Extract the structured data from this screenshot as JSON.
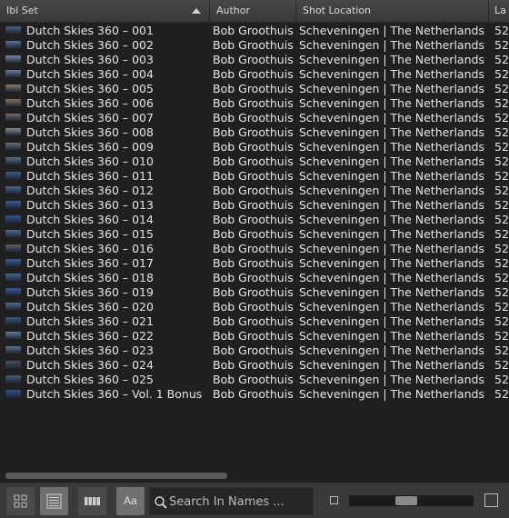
{
  "columns": {
    "ibl_set": "Ibl Set",
    "author": "Author",
    "shot_location": "Shot Location",
    "extra": "La"
  },
  "rows": [
    {
      "name": "Dutch Skies 360 – 001",
      "author": "Bob Groothuis",
      "location": "Scheveningen | The Netherlands",
      "extra": "52",
      "thumb_color": "#4a5f7e"
    },
    {
      "name": "Dutch Skies 360 – 002",
      "author": "Bob Groothuis",
      "location": "Scheveningen | The Netherlands",
      "extra": "52",
      "thumb_color": "#5d7091"
    },
    {
      "name": "Dutch Skies 360 – 003",
      "author": "Bob Groothuis",
      "location": "Scheveningen | The Netherlands",
      "extra": "52",
      "thumb_color": "#7c8aa0"
    },
    {
      "name": "Dutch Skies 360 – 004",
      "author": "Bob Groothuis",
      "location": "Scheveningen | The Netherlands",
      "extra": "52",
      "thumb_color": "#6e7c92"
    },
    {
      "name": "Dutch Skies 360 – 005",
      "author": "Bob Groothuis",
      "location": "Scheveningen | The Netherlands",
      "extra": "52",
      "thumb_color": "#8a7a6a"
    },
    {
      "name": "Dutch Skies 360 – 006",
      "author": "Bob Groothuis",
      "location": "Scheveningen | The Netherlands",
      "extra": "52",
      "thumb_color": "#8f6e55"
    },
    {
      "name": "Dutch Skies 360 – 007",
      "author": "Bob Groothuis",
      "location": "Scheveningen | The Netherlands",
      "extra": "52",
      "thumb_color": "#7a6a5e"
    },
    {
      "name": "Dutch Skies 360 – 008",
      "author": "Bob Groothuis",
      "location": "Scheveningen | The Netherlands",
      "extra": "52",
      "thumb_color": "#8a8a88"
    },
    {
      "name": "Dutch Skies 360 – 009",
      "author": "Bob Groothuis",
      "location": "Scheveningen | The Netherlands",
      "extra": "52",
      "thumb_color": "#6d6d70"
    },
    {
      "name": "Dutch Skies 360 – 010",
      "author": "Bob Groothuis",
      "location": "Scheveningen | The Netherlands",
      "extra": "52",
      "thumb_color": "#5a6c84"
    },
    {
      "name": "Dutch Skies 360 – 011",
      "author": "Bob Groothuis",
      "location": "Scheveningen | The Netherlands",
      "extra": "52",
      "thumb_color": "#3f5a86"
    },
    {
      "name": "Dutch Skies 360 – 012",
      "author": "Bob Groothuis",
      "location": "Scheveningen | The Netherlands",
      "extra": "52",
      "thumb_color": "#4d6590"
    },
    {
      "name": "Dutch Skies 360 – 013",
      "author": "Bob Groothuis",
      "location": "Scheveningen | The Netherlands",
      "extra": "52",
      "thumb_color": "#3a5c8e"
    },
    {
      "name": "Dutch Skies 360 – 014",
      "author": "Bob Groothuis",
      "location": "Scheveningen | The Netherlands",
      "extra": "52",
      "thumb_color": "#34578f"
    },
    {
      "name": "Dutch Skies 360 – 015",
      "author": "Bob Groothuis",
      "location": "Scheveningen | The Netherlands",
      "extra": "52",
      "thumb_color": "#4f6a8c"
    },
    {
      "name": "Dutch Skies 360 – 016",
      "author": "Bob Groothuis",
      "location": "Scheveningen | The Netherlands",
      "extra": "52",
      "thumb_color": "#5e5e62"
    },
    {
      "name": "Dutch Skies 360 – 017",
      "author": "Bob Groothuis",
      "location": "Scheveningen | The Netherlands",
      "extra": "52",
      "thumb_color": "#3d5f96"
    },
    {
      "name": "Dutch Skies 360 – 018",
      "author": "Bob Groothuis",
      "location": "Scheveningen | The Netherlands",
      "extra": "52",
      "thumb_color": "#466795"
    },
    {
      "name": "Dutch Skies 360 – 019",
      "author": "Bob Groothuis",
      "location": "Scheveningen | The Netherlands",
      "extra": "52",
      "thumb_color": "#355a92"
    },
    {
      "name": "Dutch Skies 360 – 020",
      "author": "Bob Groothuis",
      "location": "Scheveningen | The Netherlands",
      "extra": "52",
      "thumb_color": "#55698a"
    },
    {
      "name": "Dutch Skies 360 – 021",
      "author": "Bob Groothuis",
      "location": "Scheveningen | The Netherlands",
      "extra": "52",
      "thumb_color": "#3e5680"
    },
    {
      "name": "Dutch Skies 360 – 022",
      "author": "Bob Groothuis",
      "location": "Scheveningen | The Netherlands",
      "extra": "52",
      "thumb_color": "#6a7890"
    },
    {
      "name": "Dutch Skies 360 – 023",
      "author": "Bob Groothuis",
      "location": "Scheveningen | The Netherlands",
      "extra": "52",
      "thumb_color": "#5c6f8a"
    },
    {
      "name": "Dutch Skies 360 – 024",
      "author": "Bob Groothuis",
      "location": "Scheveningen | The Netherlands",
      "extra": "52",
      "thumb_color": "#4b4f58"
    },
    {
      "name": "Dutch Skies 360 – 025",
      "author": "Bob Groothuis",
      "location": "Scheveningen | The Netherlands",
      "extra": "52",
      "thumb_color": "#4a5870"
    },
    {
      "name": "Dutch Skies 360 – Vol. 1 Bonus",
      "author": "Bob Groothuis",
      "location": "Scheveningen | The Netherlands",
      "extra": "52",
      "thumb_color": "#2f4f86"
    }
  ],
  "toolbar": {
    "grid_view_icon": "grid-view-icon",
    "list_view_icon": "list-view-icon",
    "filmstrip_view_icon": "filmstrip-view-icon",
    "text_size_label": "Aa",
    "search_placeholder": "Search In Names ...",
    "thumbnail_size_level": 0.45
  },
  "colors": {
    "header_bg": "#3a3a3a",
    "list_bg": "#202020",
    "text": "#e6e6e6",
    "active_button": "#6f6f6f"
  }
}
